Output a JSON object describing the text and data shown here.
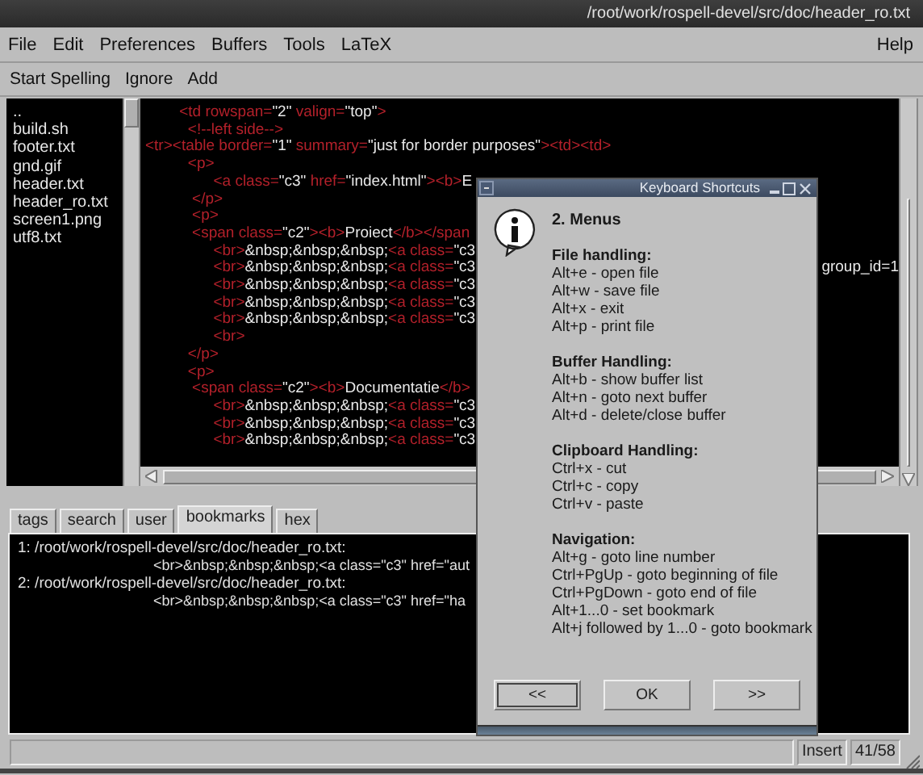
{
  "window": {
    "title": "/root/work/rospell-devel/src/doc/header_ro.txt"
  },
  "menu": [
    {
      "label": "File"
    },
    {
      "label": "Edit"
    },
    {
      "label": "Preferences"
    },
    {
      "label": "Buffers"
    },
    {
      "label": "Tools"
    },
    {
      "label": "LaTeX"
    }
  ],
  "help_menu": {
    "label": "Help"
  },
  "toolbar": [
    "Start Spelling",
    "Ignore",
    "Add"
  ],
  "files": [
    "..",
    "build.sh",
    "footer.txt",
    "gnd.gif",
    "header.txt",
    "header_ro.txt",
    "screen1.png",
    "utf8.txt"
  ],
  "editor": {
    "lines": [
      {
        "segments": [
          {
            "kind": "tag",
            "text": "        <td rowspan="
          },
          {
            "kind": "text",
            "text": "\"2\""
          },
          {
            "kind": "tag",
            "text": " valign="
          },
          {
            "kind": "text",
            "text": "\"top\""
          },
          {
            "kind": "tag",
            "text": ">"
          }
        ]
      },
      {
        "segments": [
          {
            "kind": "tag",
            "text": "          <!--left side-->"
          }
        ]
      },
      {
        "segments": [
          {
            "kind": "tag",
            "text": "<tr><table border="
          },
          {
            "kind": "text",
            "text": "\"1\""
          },
          {
            "kind": "tag",
            "text": " summary="
          },
          {
            "kind": "text",
            "text": "\"just for border purposes\""
          },
          {
            "kind": "tag",
            "text": "><td><td>"
          }
        ]
      },
      {
        "segments": [
          {
            "kind": "tag",
            "text": "          <p>"
          }
        ]
      },
      {
        "segments": [
          {
            "kind": "tag",
            "text": "                <a class="
          },
          {
            "kind": "text",
            "text": "\"c3\""
          },
          {
            "kind": "tag",
            "text": " href="
          },
          {
            "kind": "text",
            "text": "\"index.html\""
          },
          {
            "kind": "tag",
            "text": "><b>"
          },
          {
            "kind": "text",
            "text": "E"
          }
        ]
      },
      {
        "segments": [
          {
            "kind": "tag",
            "text": "           </p>"
          }
        ]
      },
      {
        "segments": [
          {
            "kind": "tag",
            "text": "           <p>"
          }
        ]
      },
      {
        "segments": [
          {
            "kind": "tag",
            "text": "           <span class="
          },
          {
            "kind": "text",
            "text": "\"c2\""
          },
          {
            "kind": "tag",
            "text": "><b>"
          },
          {
            "kind": "text",
            "text": "Proiect"
          },
          {
            "kind": "tag",
            "text": "</b></span"
          }
        ]
      },
      {
        "segments": [
          {
            "kind": "tag",
            "text": "                <br>"
          },
          {
            "kind": "text",
            "text": "&nbsp;&nbsp;&nbsp;"
          },
          {
            "kind": "tag",
            "text": "<a class="
          },
          {
            "kind": "text",
            "text": "\"c3"
          }
        ]
      },
      {
        "segments": [
          {
            "kind": "tag",
            "text": "                <br>"
          },
          {
            "kind": "text",
            "text": "&nbsp;&nbsp;&nbsp;"
          },
          {
            "kind": "tag",
            "text": "<a class="
          },
          {
            "kind": "text",
            "text": "\"c3"
          }
        ],
        "tail": "group_id=1"
      },
      {
        "segments": [
          {
            "kind": "tag",
            "text": "                <br>"
          },
          {
            "kind": "text",
            "text": "&nbsp;&nbsp;&nbsp;"
          },
          {
            "kind": "tag",
            "text": "<a class="
          },
          {
            "kind": "text",
            "text": "\"c3"
          }
        ]
      },
      {
        "segments": [
          {
            "kind": "tag",
            "text": "                <br>"
          },
          {
            "kind": "text",
            "text": "&nbsp;&nbsp;&nbsp;"
          },
          {
            "kind": "tag",
            "text": "<a class="
          },
          {
            "kind": "text",
            "text": "\"c3"
          }
        ]
      },
      {
        "segments": [
          {
            "kind": "tag",
            "text": "                <br>"
          },
          {
            "kind": "text",
            "text": "&nbsp;&nbsp;&nbsp;"
          },
          {
            "kind": "tag",
            "text": "<a class="
          },
          {
            "kind": "text",
            "text": "\"c3"
          }
        ]
      },
      {
        "segments": [
          {
            "kind": "tag",
            "text": "                <br>"
          }
        ]
      },
      {
        "segments": [
          {
            "kind": "tag",
            "text": "          </p>"
          }
        ]
      },
      {
        "segments": [
          {
            "kind": "tag",
            "text": "          <p>"
          }
        ]
      },
      {
        "segments": [
          {
            "kind": "tag",
            "text": "           <span class="
          },
          {
            "kind": "text",
            "text": "\"c2\""
          },
          {
            "kind": "tag",
            "text": "><b>"
          },
          {
            "kind": "text",
            "text": "Documentatie"
          },
          {
            "kind": "tag",
            "text": "</b>"
          }
        ]
      },
      {
        "segments": [
          {
            "kind": "tag",
            "text": "                <br>"
          },
          {
            "kind": "text",
            "text": "&nbsp;&nbsp;&nbsp;"
          },
          {
            "kind": "tag",
            "text": "<a class="
          },
          {
            "kind": "text",
            "text": "\"c3"
          }
        ]
      },
      {
        "segments": [
          {
            "kind": "tag",
            "text": "                <br>"
          },
          {
            "kind": "text",
            "text": "&nbsp;&nbsp;&nbsp;"
          },
          {
            "kind": "tag",
            "text": "<a class="
          },
          {
            "kind": "text",
            "text": "\"c3"
          }
        ]
      },
      {
        "segments": [
          {
            "kind": "tag",
            "text": "                <br>"
          },
          {
            "kind": "text",
            "text": "&nbsp;&nbsp;&nbsp;"
          },
          {
            "kind": "tag",
            "text": "<a class="
          },
          {
            "kind": "text",
            "text": "\"c3"
          }
        ]
      }
    ]
  },
  "bottom_tabs": [
    {
      "label": "tags",
      "selected": false
    },
    {
      "label": "search",
      "selected": false
    },
    {
      "label": "user",
      "selected": false
    },
    {
      "label": "bookmarks",
      "selected": true
    },
    {
      "label": "hex",
      "selected": false
    }
  ],
  "output_lines": [
    {
      "kind": "path",
      "text": "1: /root/work/rospell-devel/src/doc/header_ro.txt:"
    },
    {
      "kind": "match",
      "text": "<br>&nbsp;&nbsp;&nbsp;<a class=\"c3\" href=\"aut"
    },
    {
      "kind": "path",
      "text": "2: /root/work/rospell-devel/src/doc/header_ro.txt:"
    },
    {
      "kind": "match",
      "text": "<br>&nbsp;&nbsp;&nbsp;<a class=\"c3\" href=\"ha"
    }
  ],
  "status_bar": {
    "mode": "Insert",
    "position": "41/58"
  },
  "dialog": {
    "title": "Keyboard Shortcuts",
    "heading": "2. Menus",
    "sections": [
      {
        "title": "File handling:",
        "items": [
          "Alt+e - open file",
          "Alt+w - save file",
          "Alt+x - exit",
          "Alt+p - print file"
        ]
      },
      {
        "title": "Buffer Handling:",
        "items": [
          "Alt+b - show buffer list",
          "Alt+n - goto next buffer",
          "Alt+d - delete/close buffer"
        ]
      },
      {
        "title": "Clipboard Handling:",
        "items": [
          "Ctrl+x - cut",
          "Ctrl+c - copy",
          "Ctrl+v - paste"
        ]
      },
      {
        "title": "Navigation:",
        "items": [
          "Alt+g - goto line number",
          "Ctrl+PgUp - goto beginning of file",
          "Ctrl+PgDown - goto end of file",
          "Alt+1...0 - set bookmark",
          "Alt+j followed by 1...0 - goto bookmark"
        ]
      }
    ],
    "buttons": [
      {
        "label": "<<",
        "focused": true
      },
      {
        "label": "OK",
        "focused": false
      },
      {
        "label": ">>",
        "focused": false
      }
    ]
  }
}
